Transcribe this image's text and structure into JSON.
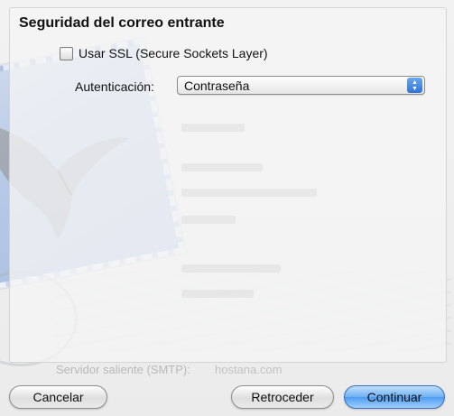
{
  "section": {
    "title": "Seguridad del correo entrante"
  },
  "ssl": {
    "label": "Usar SSL (Secure Sockets Layer)",
    "checked": false
  },
  "auth": {
    "label": "Autenticación:",
    "selected": "Contraseña"
  },
  "background": {
    "outgoing_label": "Servidor saliente (SMTP):",
    "outgoing_value": "hostana.com"
  },
  "buttons": {
    "cancel": "Cancelar",
    "back": "Retroceder",
    "continue": "Continuar"
  },
  "colors": {
    "default_button": "#6fb0f4",
    "stamp": "#aec3e6"
  }
}
